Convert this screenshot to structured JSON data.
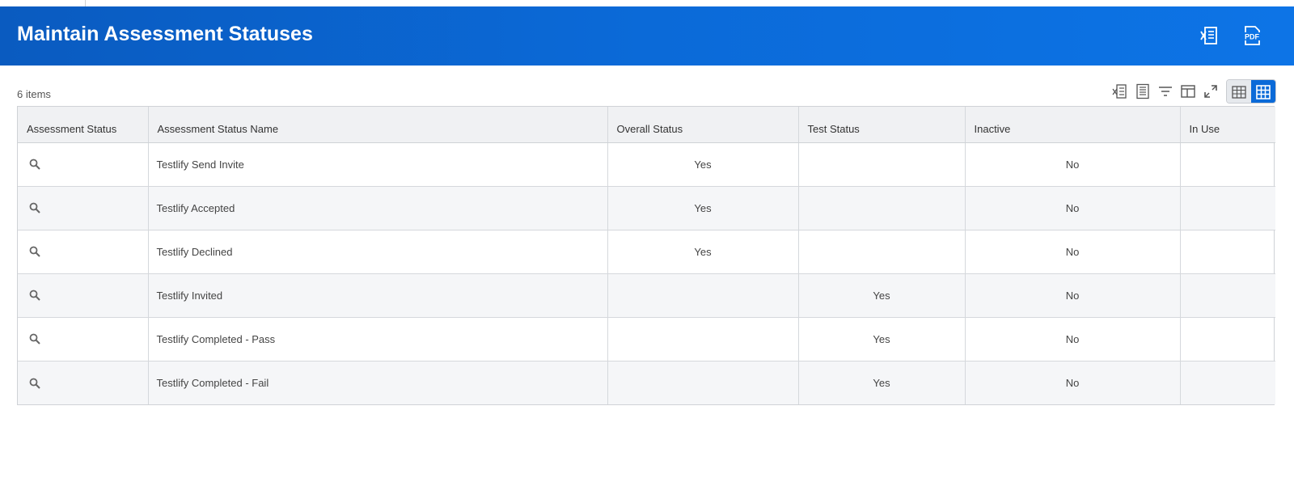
{
  "header": {
    "title": "Maintain Assessment Statuses",
    "excel_icon": "excel-export-icon",
    "pdf_icon": "pdf-export-icon",
    "pdf_label": "PDF",
    "color": "#0b6ad8"
  },
  "grid": {
    "item_count": "6 items",
    "toolbar_icons": [
      "excel-export-icon",
      "form-view-icon",
      "filter-icon",
      "column-layout-icon",
      "fullscreen-icon",
      "table-view-icon",
      "grid-view-icon"
    ],
    "columns": [
      "Assessment Status",
      "Assessment Status Name",
      "Overall Status",
      "Test Status",
      "Inactive",
      "In Use"
    ],
    "rows": [
      {
        "name": "Testlify Send Invite",
        "overall": "Yes",
        "test": "",
        "inactive": "No",
        "in_use": ""
      },
      {
        "name": "Testlify Accepted",
        "overall": "Yes",
        "test": "",
        "inactive": "No",
        "in_use": ""
      },
      {
        "name": "Testlify Declined",
        "overall": "Yes",
        "test": "",
        "inactive": "No",
        "in_use": ""
      },
      {
        "name": "Testlify Invited",
        "overall": "",
        "test": "Yes",
        "inactive": "No",
        "in_use": ""
      },
      {
        "name": "Testlify Completed - Pass",
        "overall": "",
        "test": "Yes",
        "inactive": "No",
        "in_use": ""
      },
      {
        "name": "Testlify Completed - Fail",
        "overall": "",
        "test": "Yes",
        "inactive": "No",
        "in_use": ""
      }
    ]
  }
}
